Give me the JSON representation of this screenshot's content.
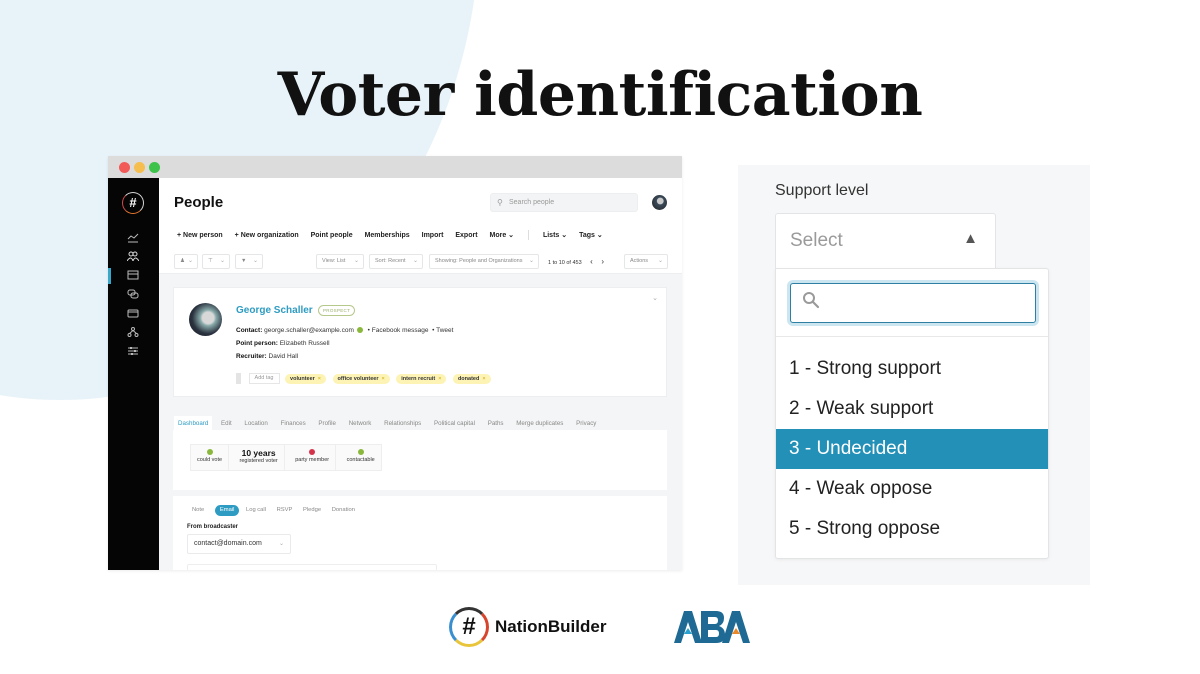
{
  "slide": {
    "title": "Voter identification"
  },
  "app": {
    "page_title": "People",
    "search_placeholder": "Search people",
    "sidebar": {
      "logo": "#",
      "icons": [
        "dashboard-chart-icon",
        "people-icon",
        "calendar-icon",
        "chat-icon",
        "finance-card-icon",
        "network-icon",
        "settings-sliders-icon"
      ],
      "active_index": 1
    },
    "actions": [
      {
        "label": "+ New person"
      },
      {
        "label": "+ New organization"
      },
      {
        "label": "Point people"
      },
      {
        "label": "Memberships"
      },
      {
        "label": "Import"
      },
      {
        "label": "Export"
      },
      {
        "label": "More ⌄"
      }
    ],
    "actions_secondary": [
      {
        "label": "Lists ⌄"
      },
      {
        "label": "Tags ⌄"
      }
    ],
    "filters": {
      "view": "View: List",
      "sort": "Sort: Recent",
      "showing": "Showing: People and Organizations",
      "pager_text": "1 to 10 of 453",
      "actions": "Actions"
    },
    "person": {
      "name": "George Schaller",
      "status": "PROSPECT",
      "contact_label": "Contact:",
      "contact_email": "george.schaller@example.com",
      "contact_channels": [
        "Facebook message",
        "Tweet"
      ],
      "point_person_label": "Point person:",
      "point_person": "Elizabeth Russell",
      "recruiter_label": "Recruiter:",
      "recruiter": "David Hall",
      "add_tag_placeholder": "Add tag",
      "tags": [
        "volunteer",
        "office volunteer",
        "intern recruit",
        "donated"
      ]
    },
    "profile_tabs": [
      "Dashboard",
      "Edit",
      "Location",
      "Finances",
      "Profile",
      "Network",
      "Relationships",
      "Political capital",
      "Paths",
      "Merge duplicates",
      "Privacy"
    ],
    "active_profile_tab": "Dashboard",
    "stats": [
      {
        "value": "",
        "label": "could vote",
        "status": "ok"
      },
      {
        "value": "10 years",
        "label": "registered voter",
        "status": ""
      },
      {
        "value": "",
        "label": "party member",
        "status": "bad"
      },
      {
        "value": "",
        "label": "contactable",
        "status": "ok"
      }
    ],
    "composer": {
      "tabs": [
        "Note",
        "Email",
        "Log call",
        "RSVP",
        "Pledge",
        "Donation"
      ],
      "active_tab": "Email",
      "from_label": "From broadcaster",
      "from_value": "contact@domain.com"
    }
  },
  "support_level": {
    "label": "Support level",
    "placeholder": "Select",
    "search_value": "",
    "options": [
      {
        "label": "1 - Strong support"
      },
      {
        "label": "2 - Weak support"
      },
      {
        "label": "3 - Undecided"
      },
      {
        "label": "4 - Weak oppose"
      },
      {
        "label": "5 - Strong oppose"
      }
    ],
    "highlighted_index": 2,
    "highlight_color": "#2390b8"
  },
  "logos": {
    "nationbuilder": "NationBuilder",
    "aba": "ABA"
  }
}
